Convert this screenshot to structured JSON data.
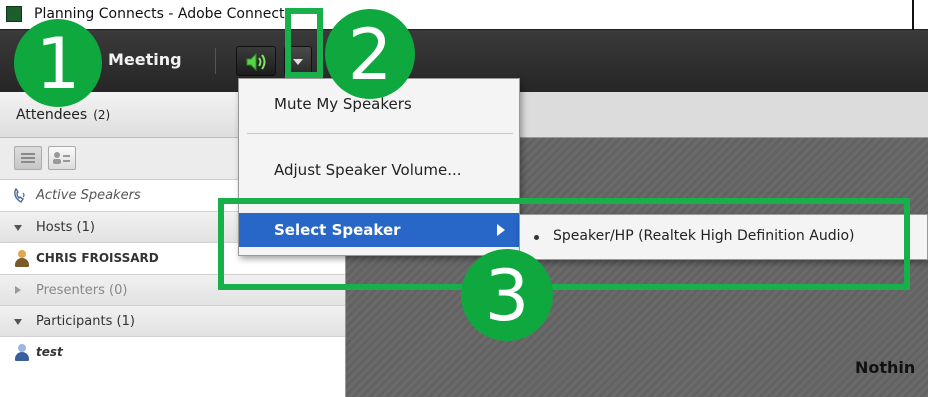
{
  "window": {
    "title": "Planning Connects - Adobe Connect"
  },
  "toolbar": {
    "meeting_label": "Meeting"
  },
  "attendees": {
    "title": "Attendees",
    "count": "(2)",
    "active_speakers": "Active Speakers",
    "hosts": {
      "label": "Hosts (1)",
      "members": [
        "CHRIS FROISSARD"
      ]
    },
    "presenters": {
      "label": "Presenters (0)"
    },
    "participants": {
      "label": "Participants (1)",
      "members": [
        "test"
      ]
    }
  },
  "speaker_menu": {
    "items": [
      "Mute My Speakers",
      "Adjust Speaker Volume...",
      "Select Speaker"
    ],
    "submenu": [
      "Speaker/HP (Realtek High Definition Audio)"
    ]
  },
  "stage": {
    "message": "Nothin"
  },
  "annotations": {
    "steps": [
      "1",
      "2",
      "3"
    ]
  },
  "colors": {
    "annotation_green": "#0fa83f",
    "menu_highlight": "#2866c8",
    "toolbar_bg": "#2e2e2e"
  },
  "icons": [
    "app-icon",
    "speaker-icon",
    "dropdown-caret-icon",
    "list-view-icon",
    "grid-view-icon",
    "phone-speaker-icon",
    "host-icon",
    "participant-icon",
    "submenu-arrow-icon"
  ]
}
